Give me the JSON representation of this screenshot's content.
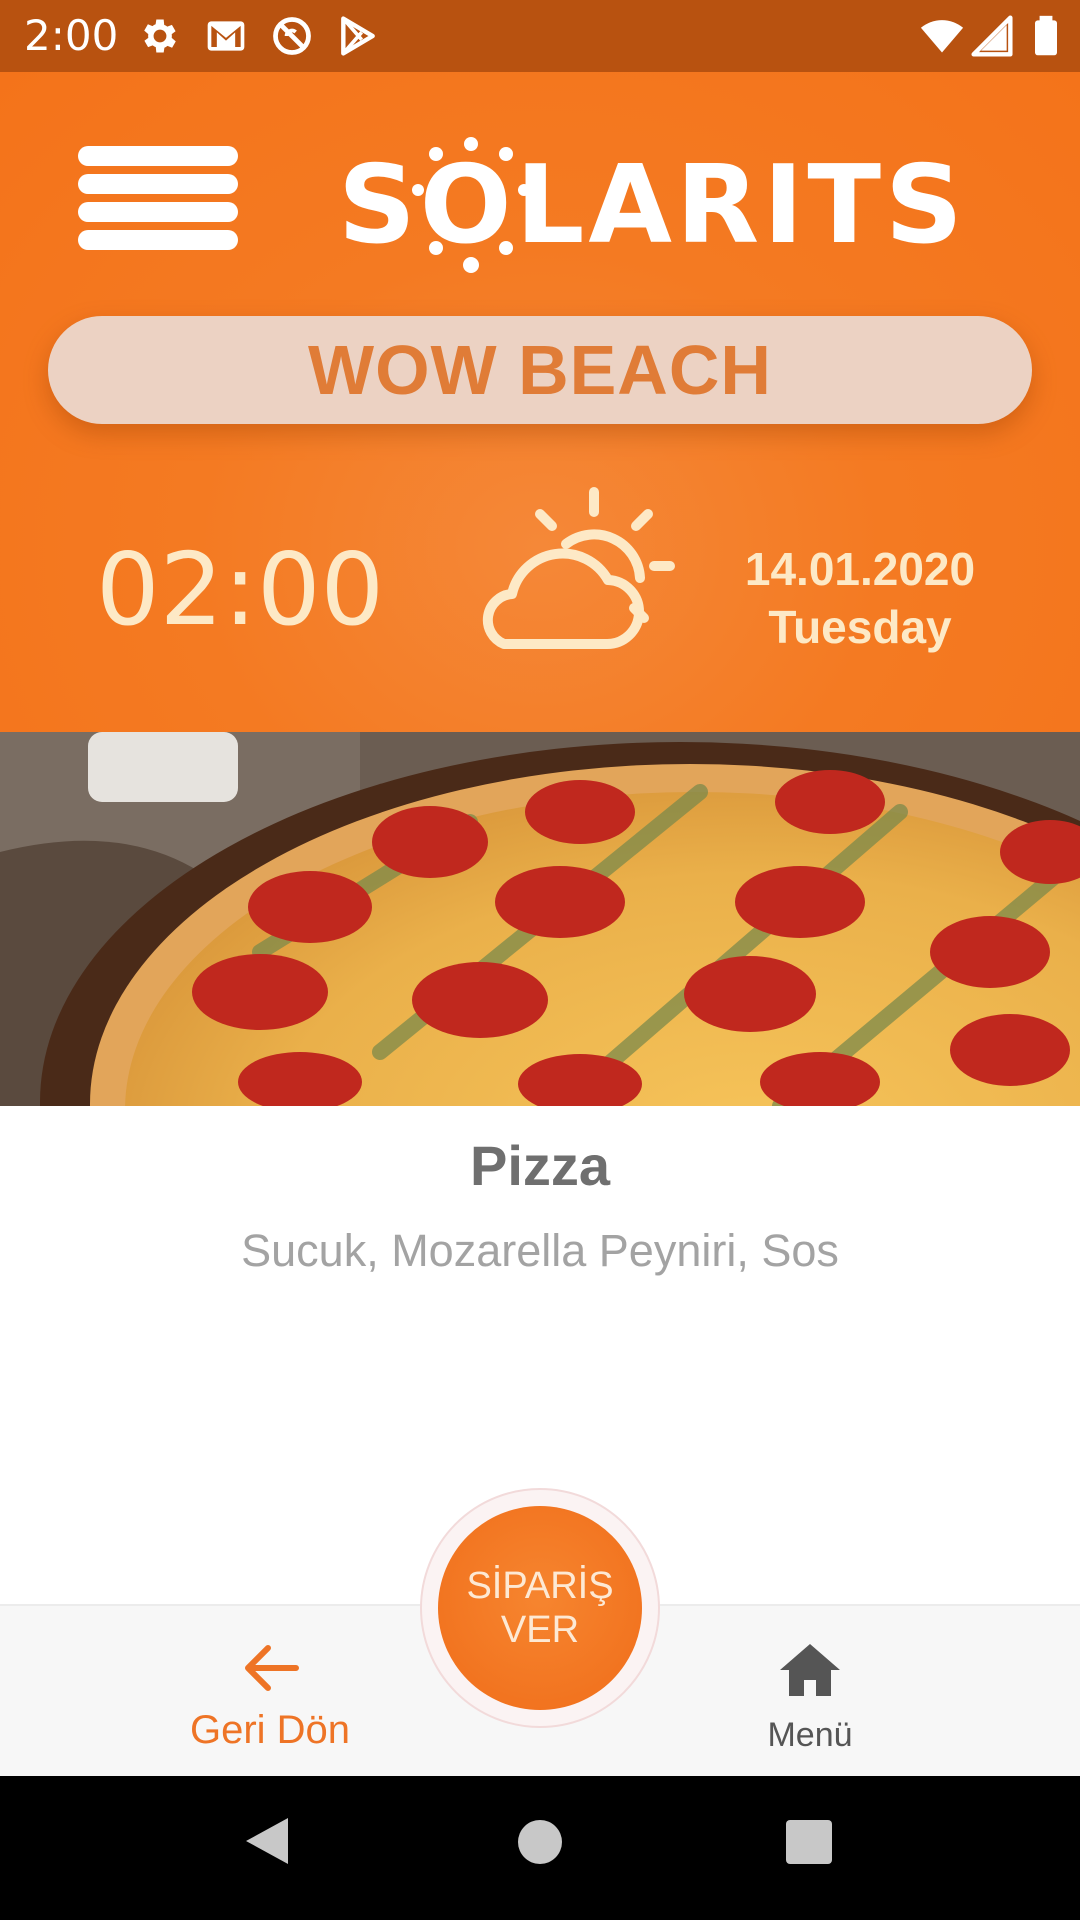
{
  "status_bar": {
    "time": "2:00",
    "left_icons": [
      "gear-icon",
      "gmail-icon",
      "no-sync-icon",
      "play-store-icon"
    ],
    "right_icons": [
      "wifi-icon",
      "signal-icon",
      "battery-icon"
    ]
  },
  "header": {
    "logo_text": "SOLARITS",
    "location": "WOW BEACH",
    "clock": "02:00",
    "weather_icon": "partly-cloudy-icon",
    "date": "14.01.2020",
    "day": "Tuesday"
  },
  "product": {
    "image": "pizza-photo",
    "name": "Pizza",
    "description": "Sucuk, Mozarella Peyniri, Sos"
  },
  "bottom_nav": {
    "back_label": "Geri Dön",
    "back_icon": "arrow-left-icon",
    "menu_label": "Menü",
    "menu_icon": "home-icon",
    "order_line1": "SİPARİŞ",
    "order_line2": "VER"
  },
  "colors": {
    "primary": "#f4731a",
    "status_bar": "#b85210",
    "pill_bg": "#ecd2c3",
    "pill_text": "#e07c37",
    "clock_text": "#fde9c6",
    "accent_text": "#ee7426"
  }
}
